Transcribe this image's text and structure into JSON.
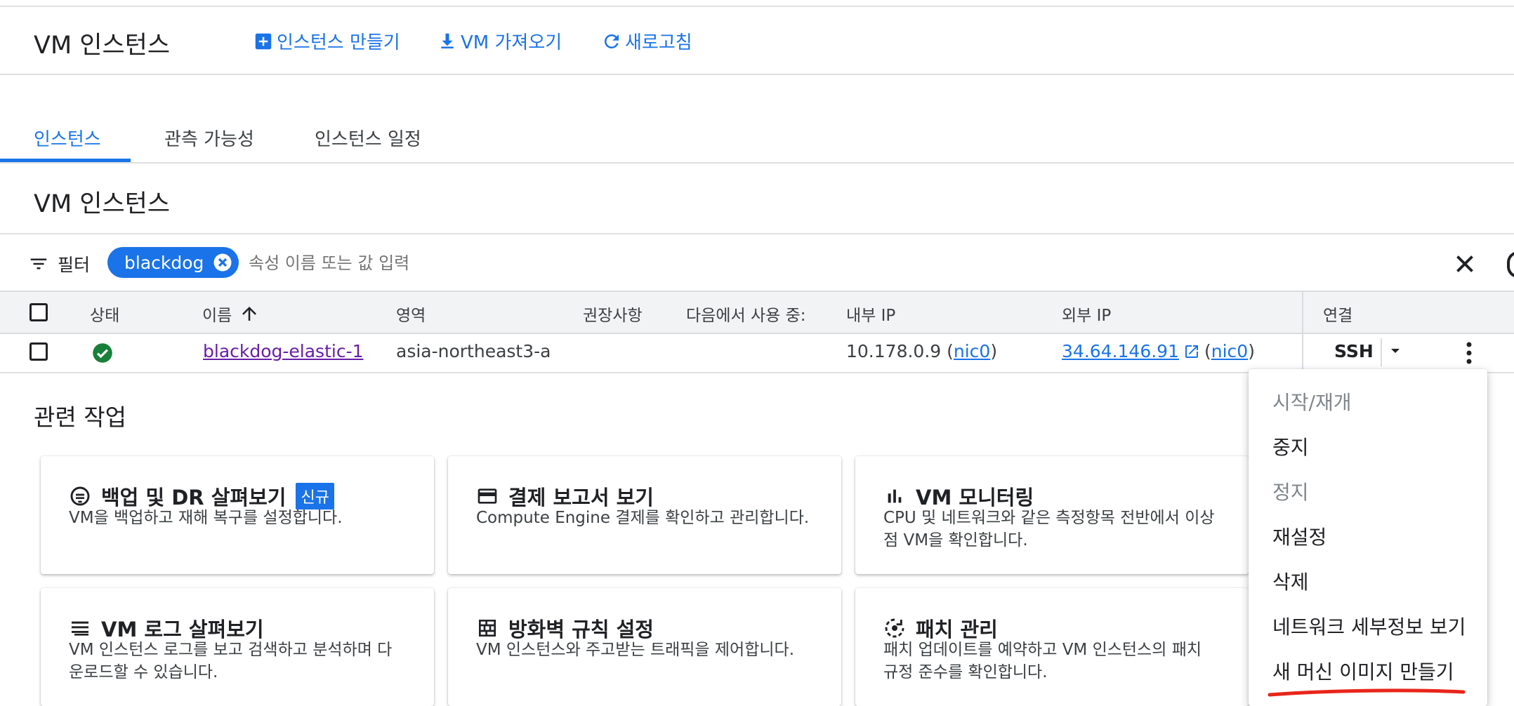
{
  "header": {
    "title": "VM 인스턴스",
    "actions": [
      {
        "label": "인스턴스 만들기",
        "icon": "add-box-icon"
      },
      {
        "label": "VM 가져오기",
        "icon": "download-icon"
      },
      {
        "label": "새로고침",
        "icon": "refresh-icon"
      }
    ]
  },
  "tabs": [
    {
      "label": "인스턴스",
      "active": true
    },
    {
      "label": "관측 가능성",
      "active": false
    },
    {
      "label": "인스턴스 일정",
      "active": false
    }
  ],
  "section_title": "VM 인스턴스",
  "filter": {
    "label": "필터",
    "chip": "blackdog",
    "placeholder": "속성 이름 또는 값 입력"
  },
  "table": {
    "columns": [
      "상태",
      "이름",
      "영역",
      "권장사항",
      "다음에서 사용 중:",
      "내부 IP",
      "외부 IP",
      "연결"
    ],
    "rows": [
      {
        "status": "running",
        "name": "blackdog-elastic-1",
        "zone": "asia-northeast3-a",
        "internal_ip": "10.178.0.9",
        "internal_nic": "nic0",
        "external_ip": "34.64.146.91",
        "external_nic": "nic0",
        "connect": "SSH"
      }
    ]
  },
  "related": {
    "title": "관련 작업",
    "cards": [
      {
        "title": "백업 및 DR 살펴보기",
        "badge": "신규",
        "desc": "VM을 백업하고 재해 복구를 설정합니다.",
        "icon": "backup-icon"
      },
      {
        "title": "결제 보고서 보기",
        "desc": "Compute Engine 결제를 확인하고 관리합니다.",
        "icon": "credit-card-icon"
      },
      {
        "title": "VM 모니터링",
        "desc": "CPU 및 네트워크와 같은 측정항목 전반에서 이상점 VM을 확인합니다.",
        "icon": "bar-chart-icon"
      },
      {
        "title": "VM 로그 살펴보기",
        "desc": "VM 인스턴스 로그를 보고 검색하고 분석하며 다운로드할 수 있습니다.",
        "icon": "list-icon"
      },
      {
        "title": "방화벽 규칙 설정",
        "desc": "VM 인스턴스와 주고받는 트래픽을 제어합니다.",
        "icon": "firewall-icon"
      },
      {
        "title": "패치 관리",
        "desc": "패치 업데이트를 예약하고 VM 인스턴스의 패치 규정 준수를 확인합니다.",
        "icon": "patch-icon"
      }
    ]
  },
  "context_menu": {
    "items": [
      {
        "label": "시작/재개",
        "disabled": true
      },
      {
        "label": "중지",
        "disabled": false
      },
      {
        "label": "정지",
        "disabled": true
      },
      {
        "label": "재설정",
        "disabled": false
      },
      {
        "label": "삭제",
        "disabled": false
      },
      {
        "label": "네트워크 세부정보 보기",
        "disabled": false
      },
      {
        "label": "새 머신 이미지 만들기",
        "disabled": false,
        "highlighted": true
      }
    ]
  },
  "colors": {
    "primary": "#1a73e8",
    "success": "#188038",
    "visited_link": "#681da8",
    "annotation": "#e8261b"
  }
}
